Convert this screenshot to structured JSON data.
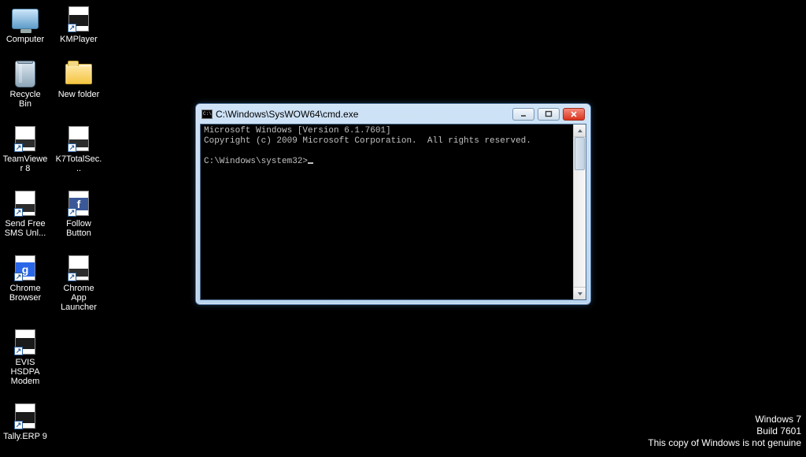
{
  "desktop": {
    "rows": [
      [
        {
          "name": "computer-icon",
          "label": "Computer",
          "glyph": "computer"
        },
        {
          "name": "kmplayer-shortcut-icon",
          "label": "KMPlayer",
          "glyph": "shortcut-dark"
        }
      ],
      [
        {
          "name": "recycle-bin-icon",
          "label": "Recycle Bin",
          "glyph": "recycle"
        },
        {
          "name": "new-folder-icon",
          "label": "New folder",
          "glyph": "folder"
        }
      ],
      [
        {
          "name": "teamviewer-shortcut-icon",
          "label": "TeamViewer 8",
          "glyph": "shortcut-page"
        },
        {
          "name": "k7totalsec-shortcut-icon",
          "label": "K7TotalSec...",
          "glyph": "shortcut-page"
        }
      ],
      [
        {
          "name": "send-free-sms-shortcut-icon",
          "label": "Send Free SMS  Unl...",
          "glyph": "shortcut-page"
        },
        {
          "name": "follow-button-shortcut-icon",
          "label": "Follow Button",
          "glyph": "shortcut-fb"
        }
      ],
      [
        {
          "name": "chrome-browser-shortcut-icon",
          "label": "Chrome Browser",
          "glyph": "shortcut-google"
        },
        {
          "name": "chrome-app-launcher-shortcut-icon",
          "label": "Chrome App Launcher",
          "glyph": "shortcut-page"
        }
      ],
      [
        {
          "name": "evis-hsdpa-modem-shortcut-icon",
          "label": "EVIS HSDPA Modem",
          "glyph": "shortcut-dark"
        }
      ],
      [
        {
          "name": "tally-erp9-shortcut-icon",
          "label": "Tally.ERP 9",
          "glyph": "shortcut-dark"
        }
      ]
    ]
  },
  "watermark": {
    "line1": "Windows 7",
    "line2": "Build 7601",
    "line3": "This copy of Windows is not genuine"
  },
  "cmd": {
    "title": "C:\\Windows\\SysWOW64\\cmd.exe",
    "line1": "Microsoft Windows [Version 6.1.7601]",
    "line2": "Copyright (c) 2009 Microsoft Corporation.  All rights reserved.",
    "prompt": "C:\\Windows\\system32>"
  }
}
